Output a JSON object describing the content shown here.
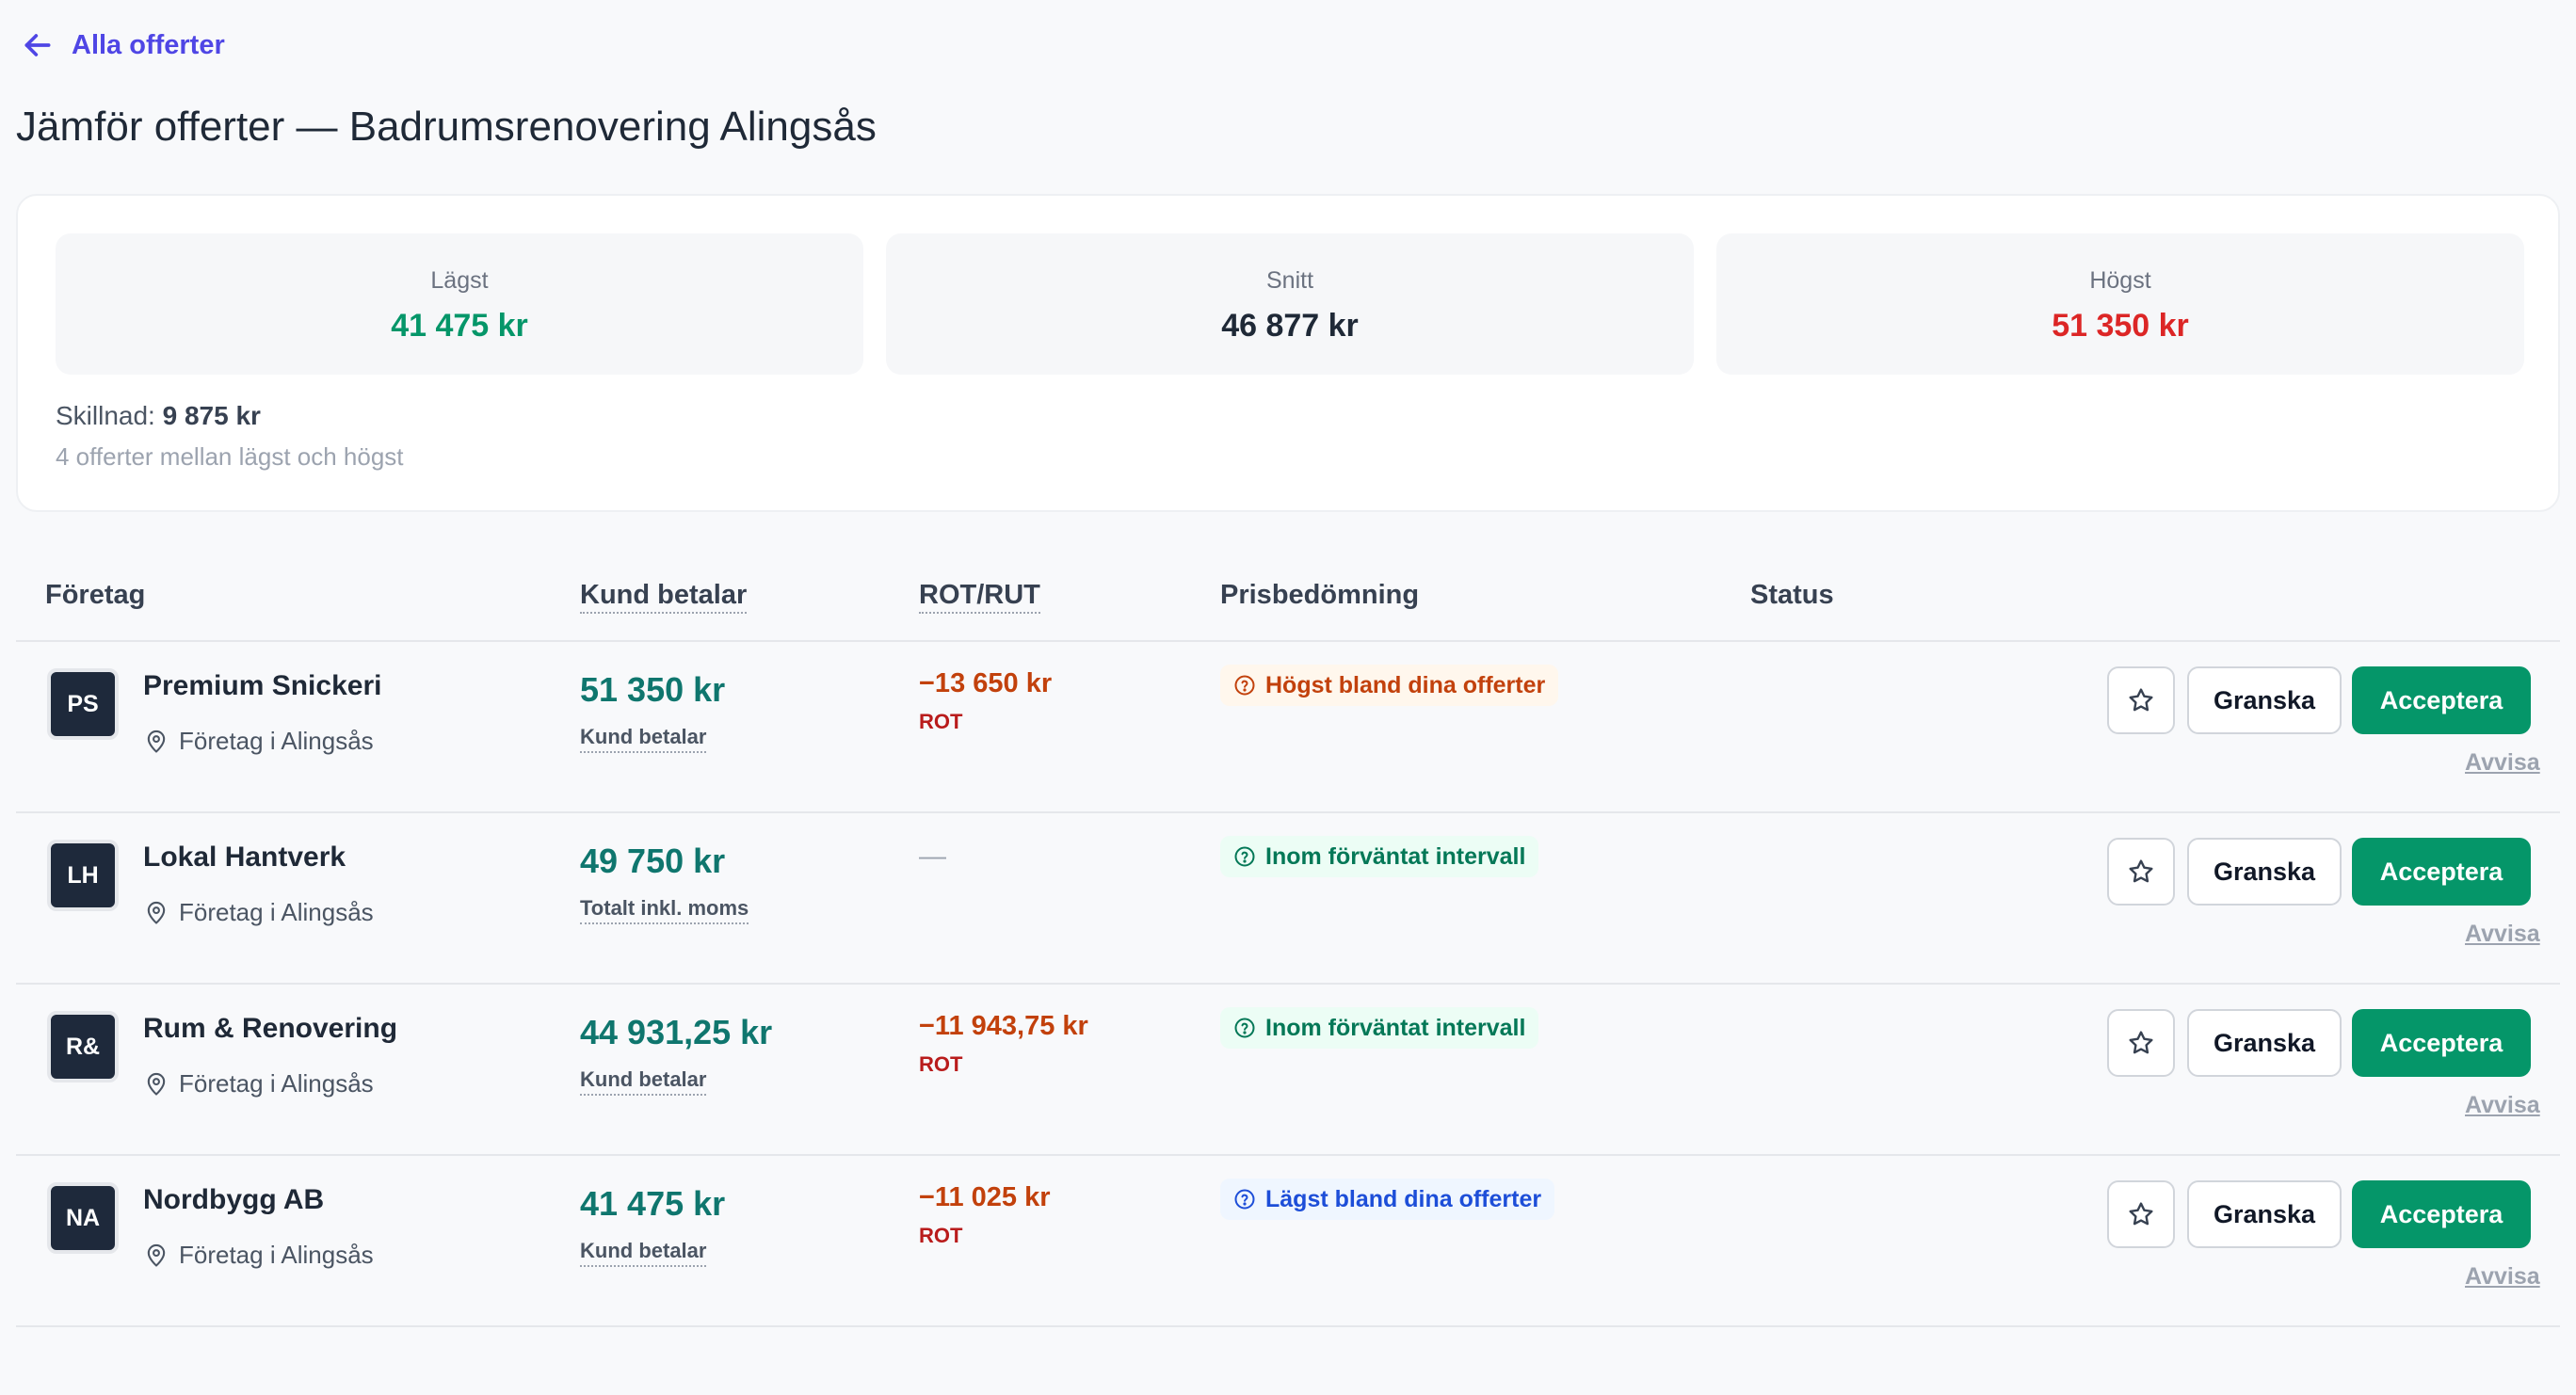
{
  "nav": {
    "back_label": "Alla offerter"
  },
  "page": {
    "title": "Jämför offerter — Badrumsrenovering Alingsås"
  },
  "summary": {
    "low_label": "Lägst",
    "low_value": "41 475 kr",
    "avg_label": "Snitt",
    "avg_value": "46 877 kr",
    "high_label": "Högst",
    "high_value": "51 350 kr",
    "diff_label": "Skillnad:",
    "diff_value": "9 875 kr",
    "diff_sub": "4 offerter mellan lägst och högst"
  },
  "table": {
    "headers": {
      "company": "Företag",
      "customer_pays": "Kund betalar",
      "rot_rut": "ROT/RUT",
      "assessment": "Prisbedömning",
      "status": "Status"
    },
    "rows": [
      {
        "initials": "PS",
        "name": "Premium Snickeri",
        "location": "Företag i Alingsås",
        "price": "51 350 kr",
        "price_sub": "Kund betalar",
        "rot": "−13 650 kr",
        "rot_type": "ROT",
        "badge": "Högst bland dina offerter",
        "badge_kind": "high",
        "review": "Granska",
        "accept": "Acceptera",
        "reject": "Avvisa"
      },
      {
        "initials": "LH",
        "name": "Lokal Hantverk",
        "location": "Företag i Alingsås",
        "price": "49 750 kr",
        "price_sub": "Totalt inkl. moms",
        "rot": "—",
        "rot_type": "",
        "badge": "Inom förväntat intervall",
        "badge_kind": "mid",
        "review": "Granska",
        "accept": "Acceptera",
        "reject": "Avvisa"
      },
      {
        "initials": "R&",
        "name": "Rum & Renovering",
        "location": "Företag i Alingsås",
        "price": "44 931,25 kr",
        "price_sub": "Kund betalar",
        "rot": "−11 943,75 kr",
        "rot_type": "ROT",
        "badge": "Inom förväntat intervall",
        "badge_kind": "mid",
        "review": "Granska",
        "accept": "Acceptera",
        "reject": "Avvisa"
      },
      {
        "initials": "NA",
        "name": "Nordbygg AB",
        "location": "Företag i Alingsås",
        "price": "41 475 kr",
        "price_sub": "Kund betalar",
        "rot": "−11 025 kr",
        "rot_type": "ROT",
        "badge": "Lägst bland dina offerter",
        "badge_kind": "low",
        "review": "Granska",
        "accept": "Acceptera",
        "reject": "Avvisa"
      }
    ]
  },
  "colors": {
    "accent": "#4f46e5",
    "accept": "#059669",
    "price": "#0f766e",
    "rot": "#c2410c",
    "low": "#059669",
    "high": "#dc2626"
  }
}
